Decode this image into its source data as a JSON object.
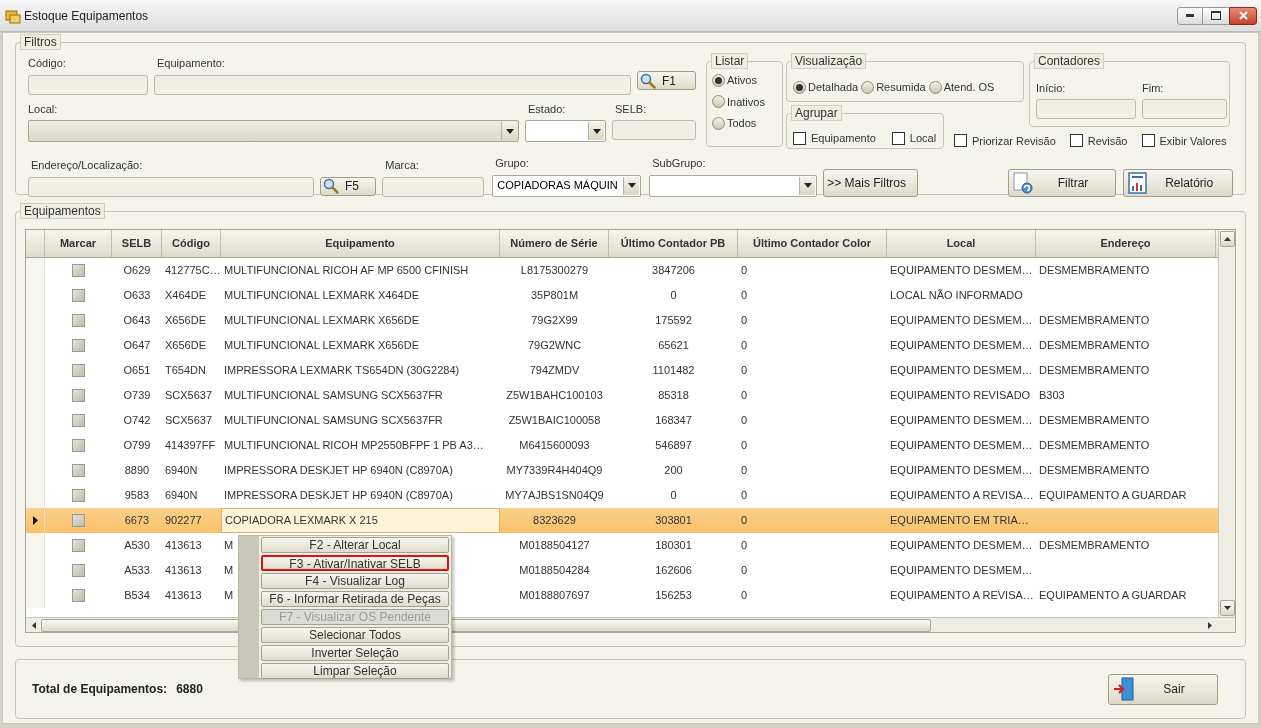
{
  "window": {
    "title": "Estoque Equipamentos"
  },
  "filters": {
    "title": "Filtros",
    "codigo": {
      "label": "Código:"
    },
    "equipamento": {
      "label": "Equipamento:"
    },
    "f1_button": "F1",
    "local": {
      "label": "Local:"
    },
    "estado": {
      "label": "Estado:"
    },
    "selb": {
      "label": "SELB:"
    },
    "endereco": {
      "label": "Endereço/Localização:"
    },
    "f5_button": "F5",
    "marca": {
      "label": "Marca:"
    },
    "grupo": {
      "label": "Grupo:",
      "value": "COPIADORAS MÁQUIN"
    },
    "subgrupo": {
      "label": "SubGrupo:"
    },
    "mais_filtros_button": ">> Mais Filtros",
    "listar": {
      "title": "Listar",
      "options": [
        {
          "label": "Ativos",
          "selected": true
        },
        {
          "label": "Inativos",
          "selected": false
        },
        {
          "label": "Todos",
          "selected": false
        }
      ]
    },
    "visualizacao": {
      "title": "Visualização",
      "options": [
        {
          "label": "Detalhada",
          "selected": true
        },
        {
          "label": "Resumida",
          "selected": false
        },
        {
          "label": "Atend. OS",
          "selected": false
        }
      ]
    },
    "agrupar": {
      "title": "Agrupar",
      "options": [
        {
          "label": "Equipamento",
          "checked": false
        },
        {
          "label": "Local",
          "checked": false
        }
      ]
    },
    "contadores": {
      "title": "Contadores",
      "inicio": "Início:",
      "fim": "Fim:"
    },
    "checkboxes": [
      {
        "label": "Priorizar Revisão",
        "checked": false
      },
      {
        "label": "Revisão",
        "checked": false
      },
      {
        "label": "Exibir Valores",
        "checked": false
      }
    ],
    "filtrar_button": "Filtrar",
    "relatorio_button": "Relatório"
  },
  "equipamentos": {
    "title": "Equipamentos",
    "columns": [
      "Marcar",
      "SELB",
      "Código",
      "Equipamento",
      "Número de Série",
      "Último Contador PB",
      "Último Contador Color",
      "Local",
      "Endereço"
    ],
    "rows": [
      {
        "selected": false,
        "checked": false,
        "cells": [
          "",
          "O629",
          "412775C…",
          "MULTIFUNCIONAL RICOH AF MP 6500 CFINISH",
          "L8175300279",
          "3847206",
          "0",
          "EQUIPAMENTO  DESMEM…",
          "DESMEMBRAMENTO"
        ]
      },
      {
        "selected": false,
        "checked": false,
        "cells": [
          "",
          "O633",
          "X464DE",
          "MULTIFUNCIONAL LEXMARK X464DE",
          "35P801M",
          "0",
          "0",
          "LOCAL NÃO INFORMADO",
          ""
        ]
      },
      {
        "selected": false,
        "checked": false,
        "cells": [
          "",
          "O643",
          "X656DE",
          "MULTIFUNCIONAL LEXMARK X656DE",
          "79G2X99",
          "175592",
          "0",
          "EQUIPAMENTO  DESMEM…",
          "DESMEMBRAMENTO"
        ]
      },
      {
        "selected": false,
        "checked": false,
        "cells": [
          "",
          "O647",
          "X656DE",
          "MULTIFUNCIONAL LEXMARK X656DE",
          "79G2WNC",
          "65621",
          "0",
          "EQUIPAMENTO  DESMEM…",
          "DESMEMBRAMENTO"
        ]
      },
      {
        "selected": false,
        "checked": false,
        "cells": [
          "",
          "O651",
          "T654DN",
          "IMPRESSORA LEXMARK TS654DN (30G2284)",
          "794ZMDV",
          "1101482",
          "0",
          "EQUIPAMENTO  DESMEM…",
          "DESMEMBRAMENTO"
        ]
      },
      {
        "selected": false,
        "checked": false,
        "cells": [
          "",
          "O739",
          "SCX5637",
          "MULTIFUNCIONAL SAMSUNG SCX5637FR",
          "Z5W1BAHC100103",
          "85318",
          "0",
          "EQUIPAMENTO REVISADO",
          "B303"
        ]
      },
      {
        "selected": false,
        "checked": false,
        "cells": [
          "",
          "O742",
          "SCX5637",
          "MULTIFUNCIONAL SAMSUNG SCX5637FR",
          "Z5W1BAIC100058",
          "168347",
          "0",
          "EQUIPAMENTO  DESMEM…",
          "DESMEMBRAMENTO"
        ]
      },
      {
        "selected": false,
        "checked": false,
        "cells": [
          "",
          "O799",
          "414397FF",
          "MULTIFUNCIONAL  RICOH  MP2550BFPF  1  PB  A3…",
          "M6415600093",
          "546897",
          "0",
          "EQUIPAMENTO  DESMEM…",
          "DESMEMBRAMENTO"
        ]
      },
      {
        "selected": false,
        "checked": false,
        "cells": [
          "",
          "8890",
          "6940N",
          "IMPRESSORA DESKJET HP 6940N (C8970A)",
          "MY7339R4H404Q9",
          "200",
          "0",
          "EQUIPAMENTO  DESMEM…",
          "DESMEMBRAMENTO"
        ]
      },
      {
        "selected": false,
        "checked": false,
        "cells": [
          "",
          "9583",
          "6940N",
          "IMPRESSORA DESKJET HP 6940N (C8970A)",
          "MY7AJBS1SN04Q9",
          "0",
          "0",
          "EQUIPAMENTO  A  REVISA…",
          "EQUIPAMENTO A GUARDAR"
        ]
      },
      {
        "selected": true,
        "checked": false,
        "cells": [
          "",
          "6673",
          "902277",
          "COPIADORA LEXMARK X 215",
          "8323629",
          "303801",
          "0",
          "EQUIPAMENTO  EM  TRIA…",
          ""
        ]
      },
      {
        "selected": false,
        "checked": false,
        "cells": [
          "",
          "A530",
          "413613",
          "M",
          "M0188504127",
          "180301",
          "0",
          "EQUIPAMENTO  DESMEM…",
          "DESMEMBRAMENTO"
        ]
      },
      {
        "selected": false,
        "checked": false,
        "cells": [
          "",
          "A533",
          "413613",
          "M",
          "M0188504284",
          "162606",
          "0",
          "EQUIPAMENTO  DESMEM…",
          ""
        ]
      },
      {
        "selected": false,
        "checked": false,
        "cells": [
          "",
          "B534",
          "413613",
          "M",
          "M0188807697",
          "156253",
          "0",
          "EQUIPAMENTO  A  REVISA…",
          "EQUIPAMENTO A GUARDAR"
        ]
      }
    ]
  },
  "context_menu": [
    {
      "label": "F2 - Alterar Local",
      "selected": false,
      "disabled": false
    },
    {
      "label": "F3 - Ativar/Inativar SELB",
      "selected": true,
      "disabled": false
    },
    {
      "label": "F4 - Visualizar Log",
      "selected": false,
      "disabled": false
    },
    {
      "label": "F6 - Informar Retirada de Peças",
      "selected": false,
      "disabled": false
    },
    {
      "label": "F7 - Visualizar OS Pendente",
      "selected": false,
      "disabled": true
    },
    {
      "label": "Selecionar Todos",
      "selected": false,
      "disabled": false
    },
    {
      "label": "Inverter Seleção",
      "selected": false,
      "disabled": false
    },
    {
      "label": "Limpar Seleção",
      "selected": false,
      "disabled": false
    }
  ],
  "footer": {
    "total_label": "Total de Equipamentos:",
    "total_value": "6880",
    "sair_button": "Sair"
  }
}
